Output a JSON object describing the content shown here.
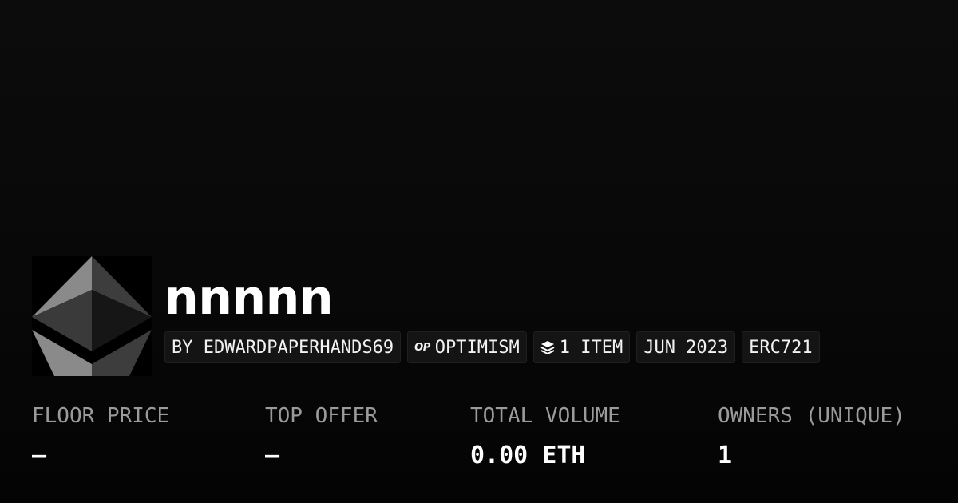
{
  "collection": {
    "name": "nnnnn",
    "avatar_icon": "ethereum-logo-icon",
    "tags": {
      "creator": "BY EDWARDPAPERHANDS69",
      "chain_icon": "OP",
      "chain": "OPTIMISM",
      "items_icon": "layers-icon",
      "items": "1 ITEM",
      "date": "JUN 2023",
      "standard": "ERC721"
    }
  },
  "stats": {
    "floor_price": {
      "label": "FLOOR PRICE",
      "value": "–"
    },
    "top_offer": {
      "label": "TOP OFFER",
      "value": "–"
    },
    "total_volume": {
      "label": "TOTAL VOLUME",
      "value": "0.00 ETH"
    },
    "owners": {
      "label": "OWNERS (UNIQUE)",
      "value": "1"
    }
  },
  "colors": {
    "background": "#0a0a0a",
    "tag_background": "#141414",
    "label": "#9b9b9b",
    "text": "#ffffff"
  }
}
